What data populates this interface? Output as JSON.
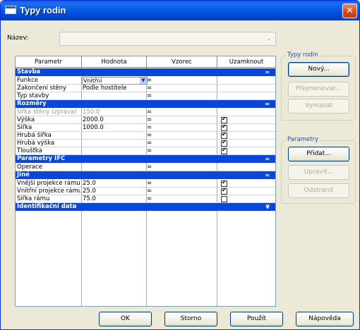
{
  "window": {
    "title": "Typy rodin",
    "close_symbol": "✕"
  },
  "name_field": {
    "label": "Název:",
    "value": ""
  },
  "grid": {
    "columns": [
      "Parametr",
      "Hodnota",
      "Vzorec",
      "Uzamknout"
    ],
    "sections": [
      {
        "title": "Stavba",
        "chevron": "≈",
        "rows": [
          {
            "param": "Funkce",
            "value": "Vnitřní",
            "formula": "=",
            "lock": null,
            "combo": true
          },
          {
            "param": "Zakončení stěny",
            "value": "Podle hostitele",
            "formula": "=",
            "lock": null
          },
          {
            "param": "Typ stavby",
            "value": "",
            "formula": "=",
            "lock": null
          }
        ]
      },
      {
        "title": "Rozměry",
        "chevron": "≈",
        "rows": [
          {
            "param": "šířka stěny (zpráva)",
            "value": "150.0",
            "formula": "=",
            "lock": null,
            "disabled": true
          },
          {
            "param": "Výška",
            "value": "2000.0",
            "formula": "=",
            "lock": true
          },
          {
            "param": "Šířka",
            "value": "1000.0",
            "formula": "=",
            "lock": true
          },
          {
            "param": "Hrubá šířka",
            "value": "",
            "formula": "=",
            "lock": true
          },
          {
            "param": "Hrubá výška",
            "value": "",
            "formula": "=",
            "lock": true
          },
          {
            "param": "Tloušťka",
            "value": "",
            "formula": "=",
            "lock": true
          }
        ]
      },
      {
        "title": "Parametry IFC",
        "chevron": "≈",
        "rows": [
          {
            "param": "Operace",
            "value": "",
            "formula": "=",
            "lock": null
          }
        ]
      },
      {
        "title": "Jiné",
        "chevron": "≈",
        "rows": [
          {
            "param": "Vnější projekce rámu",
            "value": "25.0",
            "formula": "=",
            "lock": true
          },
          {
            "param": "Vnitřní projekce rámu",
            "value": "25.0",
            "formula": "=",
            "lock": true
          },
          {
            "param": "Šířka rámu",
            "value": "75.0",
            "formula": "=",
            "lock": false
          }
        ]
      },
      {
        "title": "Identifikační data",
        "chevron": "¥",
        "rows": []
      }
    ]
  },
  "family_types_group": {
    "title": "Typy rodin",
    "buttons": [
      "Nový...",
      "Přejmenovat...",
      "Vymazat"
    ]
  },
  "parameters_group": {
    "title": "Parametry",
    "buttons": [
      "Přidat...",
      "Upravit...",
      "Odstranit"
    ]
  },
  "footer": {
    "ok": "OK",
    "cancel": "Storno",
    "apply": "Použít",
    "help": "Nápověda"
  }
}
